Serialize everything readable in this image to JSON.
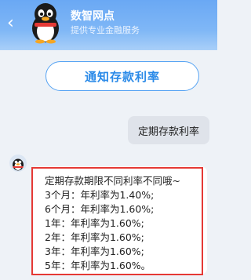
{
  "header": {
    "back_glyph": "‹",
    "title": "数智网点",
    "subtitle": "提供专业金融服务"
  },
  "quick_button": {
    "label": "通知存款利率"
  },
  "user_message": {
    "text": "定期存款利率"
  },
  "bot_message": {
    "intro": "定期存款期限不同利率不同哦~",
    "rates": [
      "3个月：年利率为1.40%;",
      "6个月：年利率为1.60%;",
      "1年：年利率为1.60%;",
      "2年：年利率为1.60%;",
      "3年：年利率为1.60%;",
      "5年：年利率为1.60%。"
    ]
  },
  "colors": {
    "header_blue": "#6aa8f4",
    "button_blue": "#2a8ae8",
    "highlight_red": "#e53935"
  },
  "icons": [
    "back-icon",
    "penguin-avatar",
    "penguin-small-avatar"
  ]
}
